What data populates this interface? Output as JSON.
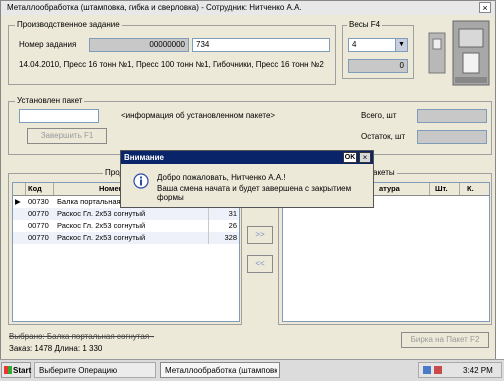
{
  "window": {
    "title": "Металлообработка (штамповка, гибка и сверловка) - Сотрудник: Нитченко А.А.",
    "close": "×"
  },
  "task": {
    "legend": "Производственное задание",
    "number_label": "Номер задания",
    "number_value": "00000000",
    "number_value2": "734",
    "details": "14.04.2010, Пресс 16 тонн №1, Пресс 100 тонн №1, Гибочники, Пресс 16 тонн №2"
  },
  "scales": {
    "legend": "Весы  F4",
    "select_value": "4",
    "weight_value": "0"
  },
  "package": {
    "legend": "Установлен пакет",
    "info": "<информация об установленном пакете>",
    "total_label": "Всего, шт",
    "remain_label": "Остаток, шт",
    "finish_button": "Завершить     F1"
  },
  "products": {
    "legend": "Прод",
    "columns": [
      "Код",
      "Номен"
    ],
    "rows": [
      {
        "code": "00730",
        "name": "Балка портальная",
        "qty": ""
      },
      {
        "code": "00770",
        "name": "Раскос Гл. 2х53 согнутый",
        "qty": "31"
      },
      {
        "code": "00770",
        "name": "Раскос Гл. 2х53 согнутый",
        "qty": "26"
      },
      {
        "code": "00770",
        "name": "Раскос Гл. 2х53 согнутый",
        "qty": "328"
      }
    ]
  },
  "packages": {
    "legend": "акеты",
    "columns": [
      "атура",
      "Шт.",
      "К."
    ]
  },
  "transfer": {
    "right": ">>",
    "left": "<<"
  },
  "footer": {
    "selected": "Выбрано: Балка портальная согнутая -",
    "order": "Заказ: 1478  Длина: 1 330",
    "tag_button": "Бирка на Пакет   F2"
  },
  "dialog": {
    "title": "Внимание",
    "ok": "OK",
    "close": "×",
    "line1": "Добро пожаловать, Нитченко А.А.!",
    "line2": "Ваша смена начата и будет завершена с закрытием формы"
  },
  "taskbar": {
    "start": "Start",
    "item1": "Выберите Операцию",
    "item2": "Металлообработка (штамповка,",
    "clock": "3:42 PM"
  }
}
